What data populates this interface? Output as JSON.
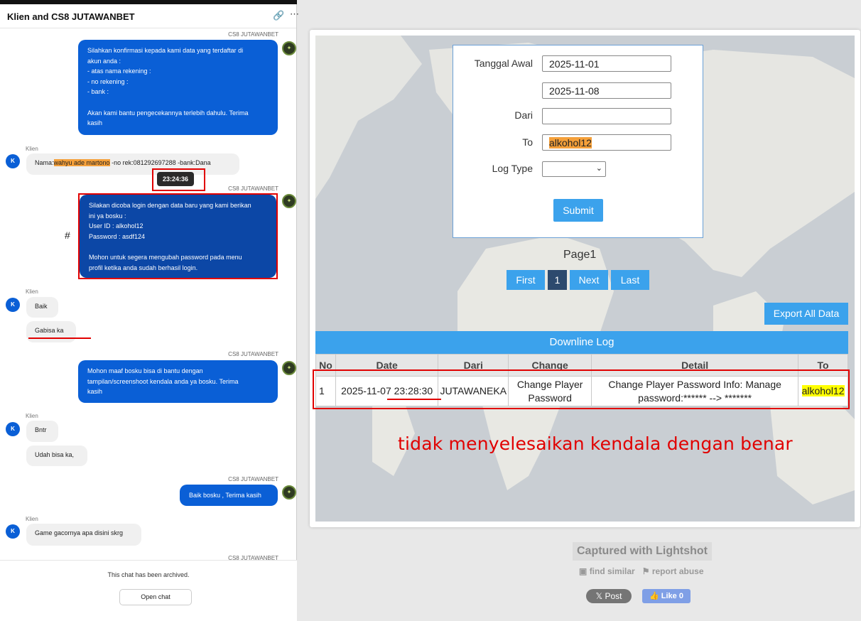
{
  "chat": {
    "title": "Klien and CS8 JUTAWANBET",
    "agent_name": "CS8 JUTAWANBET",
    "client_name": "Klien",
    "avatar_letter": "K",
    "msg1": "Silahkan konfirmasi kepada kami data yang terdaftar di\nakun anda :\n- atas nama rekening :\n- no rekening :\n- bank :\n\nAkan kami bantu pengecekannya terlebih dahulu. Terima\nkasih",
    "msg2_prefix": "Nama:",
    "msg2_highlight": "wahyu ade martono",
    "msg2_suffix": " -no rek:081292697288 -bank:Dana",
    "timestamp": "23:24:36",
    "msg3": "Silakan dicoba login dengan data baru yang kami berikan\nini ya bosku :\nUser ID : alkohol12\nPassword : asdf124\n\nMohon untuk segera mengubah password pada menu\nprofil ketika anda sudah berhasil login.",
    "hash_mark": "#",
    "msg4": "Baik",
    "msg5": "Gabisa ka",
    "msg6": "Mohon maaf bosku bisa di bantu dengan\ntampilan/screenshoot kendala anda ya bosku. Terima\nkasih",
    "msg7": "Bntr",
    "msg8": "Udah bisa ka,",
    "msg9": "Baik bosku , Terima kasih",
    "msg10": "Game gacornya apa disini skrg",
    "archived_text": "This chat has been archived.",
    "open_chat_label": "Open chat"
  },
  "form": {
    "label_start": "Tanggal Awal",
    "start_date": "2025-11-01",
    "end_date": "2025-11-08",
    "label_from": "Dari",
    "from_value": "",
    "label_to": "To",
    "to_value": "alkohol12",
    "label_logtype": "Log Type",
    "logtype_value": "",
    "submit_label": "Submit"
  },
  "pagination": {
    "page_label": "Page1",
    "first": "First",
    "current": "1",
    "next": "Next",
    "last": "Last"
  },
  "export_label": "Export All Data",
  "log_table": {
    "title": "Downline Log",
    "headers": [
      "No",
      "Date",
      "Dari",
      "Change",
      "Detail",
      "To"
    ],
    "row": {
      "no": "1",
      "date": "2025-11-07 23:28:30",
      "dari": "JUTAWANEKA",
      "change": "Change Player Password",
      "detail": "Change Player Password Info: Manage password:****** --> *******",
      "to": "alkohol12"
    }
  },
  "annotation": "tidak menyelesaikan kendala dengan benar",
  "lightshot": {
    "captured": "Captured with Lightshot",
    "find_similar": "find similar",
    "report_abuse": "report abuse",
    "post": "Post",
    "like": "Like 0"
  },
  "colors": {
    "accent_blue": "#3ba2ec",
    "chat_blue": "#0a5fd6",
    "annotation_red": "#e10000",
    "highlight_orange": "#f5a03a",
    "highlight_yellow": "#ffff00"
  }
}
